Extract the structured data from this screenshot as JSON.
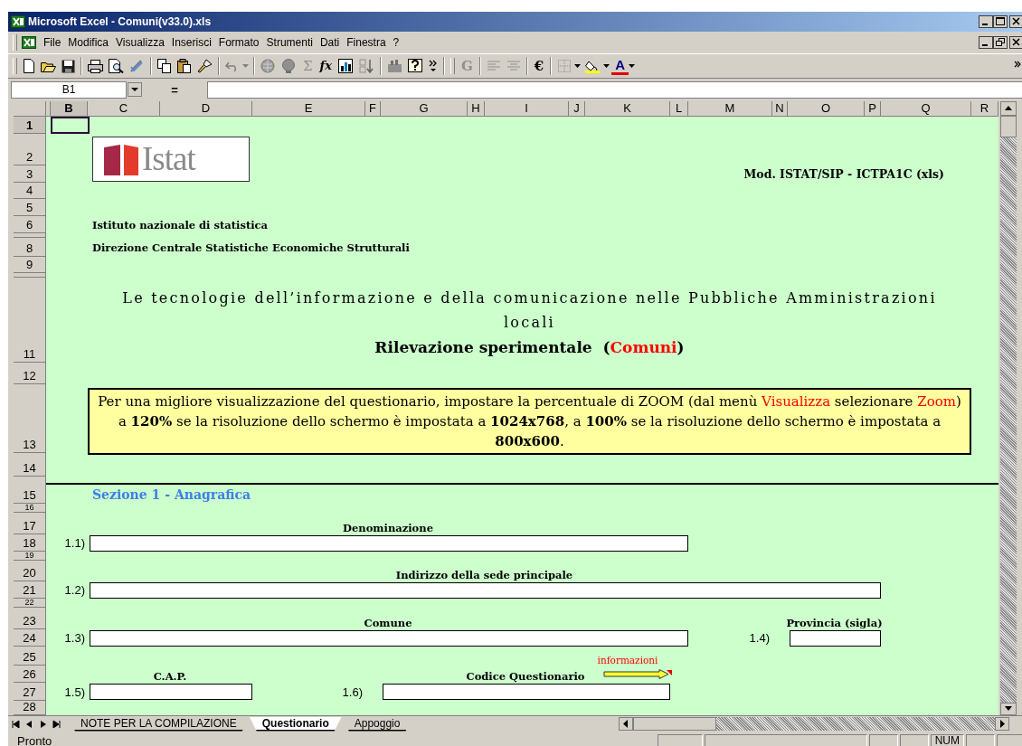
{
  "window": {
    "title": "Microsoft Excel - Comuni(v33.0).xls"
  },
  "menu_bar": {
    "items": [
      "File",
      "Modifica",
      "Visualizza",
      "Inserisci",
      "Formato",
      "Strumenti",
      "Dati",
      "Finestra",
      "?"
    ]
  },
  "toolbar": {
    "glyph_buttons": [
      {
        "text": "Σ",
        "kind": "plain",
        "disabled": true
      },
      {
        "text": "fx",
        "kind": "italic",
        "disabled": false
      },
      {
        "text": "G",
        "kind": "bold",
        "disabled": true
      },
      {
        "text": "€",
        "kind": "bold",
        "disabled": false
      },
      {
        "text": "A",
        "kind": "font-color",
        "disabled": false
      }
    ]
  },
  "formula_bar": {
    "name_box": "B1",
    "equals": "="
  },
  "columns": [
    {
      "label": "B",
      "selected": true
    },
    {
      "label": "C",
      "selected": false
    },
    {
      "label": "D",
      "selected": false
    },
    {
      "label": "E",
      "selected": false
    },
    {
      "label": "F",
      "selected": false
    },
    {
      "label": "G",
      "selected": false
    },
    {
      "label": "H",
      "selected": false
    },
    {
      "label": "I",
      "selected": false
    },
    {
      "label": "J",
      "selected": false
    },
    {
      "label": "K",
      "selected": false
    },
    {
      "label": "L",
      "selected": false
    },
    {
      "label": "M",
      "selected": false
    },
    {
      "label": "N",
      "selected": false
    },
    {
      "label": "O",
      "selected": false
    },
    {
      "label": "P",
      "selected": false
    },
    {
      "label": "Q",
      "selected": false
    },
    {
      "label": "R",
      "selected": false
    }
  ],
  "rows": [
    {
      "label": "1",
      "selected": true
    },
    {
      "label": "2",
      "selected": false
    },
    {
      "label": "3",
      "selected": false
    },
    {
      "label": "4",
      "selected": false
    },
    {
      "label": "5",
      "selected": false
    },
    {
      "label": "6",
      "selected": false
    },
    {
      "selected": false
    },
    {
      "label": "8",
      "selected": false
    },
    {
      "label": "9",
      "selected": false
    },
    {
      "selected": false
    },
    {
      "label": "11",
      "selected": false
    },
    {
      "label": "12",
      "selected": false
    },
    {
      "label": "13",
      "selected": false
    },
    {
      "label": "14",
      "selected": false
    },
    {
      "label": "15",
      "selected": false
    },
    {
      "label": "16",
      "selected": false
    },
    {
      "label": "17",
      "selected": false
    },
    {
      "label": "18",
      "selected": false
    },
    {
      "label": "19",
      "selected": false
    },
    {
      "label": "20",
      "selected": false
    },
    {
      "label": "21",
      "selected": false
    },
    {
      "label": "22",
      "selected": false
    },
    {
      "label": "23",
      "selected": false
    },
    {
      "label": "24",
      "selected": false
    },
    {
      "label": "25",
      "selected": false
    },
    {
      "label": "26",
      "selected": false
    },
    {
      "label": "27",
      "selected": false
    },
    {
      "label": "28",
      "selected": false
    }
  ],
  "sheet": {
    "logo_text": "Istat",
    "model_code": "Mod. ISTAT/SIP - ICTPA1C (xls)",
    "institute": "Istituto nazionale di statistica",
    "directorate": "Direzione Centrale Statistiche Economiche Strutturali",
    "title": "Le tecnologie dell’informazione e della comunicazione nelle Pubbliche Amministrazioni locali",
    "subtitle": [
      {
        "text": "Rilevazione sperimentale  (",
        "kind": "plain"
      },
      {
        "text": "Comuni",
        "kind": "highlight"
      },
      {
        "text": ")",
        "kind": "plain"
      }
    ],
    "notice": [
      {
        "text": "Per una migliore visualizzazione del questionario, impostare la percentuale di ZOOM (dal menù ",
        "kind": "plain"
      },
      {
        "text": "Visualizza",
        "kind": "highlight"
      },
      {
        "text": " selezionare ",
        "kind": "plain"
      },
      {
        "text": "Zoom",
        "kind": "highlight"
      },
      {
        "text": ") a ",
        "kind": "plain"
      },
      {
        "text": "120%",
        "kind": "bold"
      },
      {
        "text": " se la risoluzione dello schermo è impostata a ",
        "kind": "plain"
      },
      {
        "text": "1024x768",
        "kind": "bold"
      },
      {
        "text": ", a ",
        "kind": "plain"
      },
      {
        "text": "100%",
        "kind": "bold"
      },
      {
        "text": " se la risoluzione dello schermo è impostata a ",
        "kind": "plain"
      },
      {
        "text": "800x600",
        "kind": "bold"
      },
      {
        "text": ".",
        "kind": "plain"
      }
    ],
    "section_title": "Sezione 1 - Anagrafica",
    "fields": [
      {
        "number": "1.1)",
        "label": "Denominazione"
      },
      {
        "number": "1.2)",
        "label": "Indirizzo della sede principale"
      },
      {
        "number": "1.3)",
        "label": "Comune"
      },
      {
        "number": "1.4)",
        "label": "Provincia (sigla)"
      },
      {
        "number": "1.5)",
        "label": "C.A.P."
      },
      {
        "number": "1.6)",
        "label": "Codice Questionario"
      }
    ],
    "info_hint": "informazioni"
  },
  "sheet_tabs": [
    {
      "label": "NOTE PER LA COMPILAZIONE",
      "selected": false
    },
    {
      "label": "Questionario",
      "selected": true
    },
    {
      "label": "Appoggio",
      "selected": false
    }
  ],
  "status_bar": {
    "message": "Pronto",
    "indicators": [
      "NUM"
    ]
  }
}
